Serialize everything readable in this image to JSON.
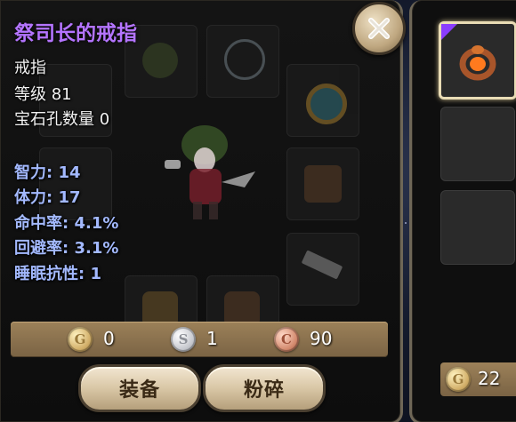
{
  "item": {
    "name": "祭司长的戒指",
    "type": "戒指",
    "level_label": "等级 81",
    "socket_label": "宝石孔数量 0"
  },
  "stats": [
    "智力: 14",
    "体力: 17",
    "命中率: 4.1%",
    "回避率: 3.1%",
    "睡眠抗性: 1"
  ],
  "currency": {
    "gold": "0",
    "silver": "1",
    "copper": "90",
    "gold_symbol": "G",
    "silver_symbol": "S",
    "copper_symbol": "C"
  },
  "buttons": {
    "equip": "装备",
    "smash": "粉碎"
  },
  "side_panel": {
    "coin_symbol": "G",
    "gold_amount": "22"
  },
  "colors": {
    "title": "#b474ff",
    "stat": "#a3b9ff",
    "text": "#f2f2f2",
    "bar": "#8b7250"
  },
  "icons": {
    "close": "close-icon",
    "selected_ring": "ring-icon"
  }
}
